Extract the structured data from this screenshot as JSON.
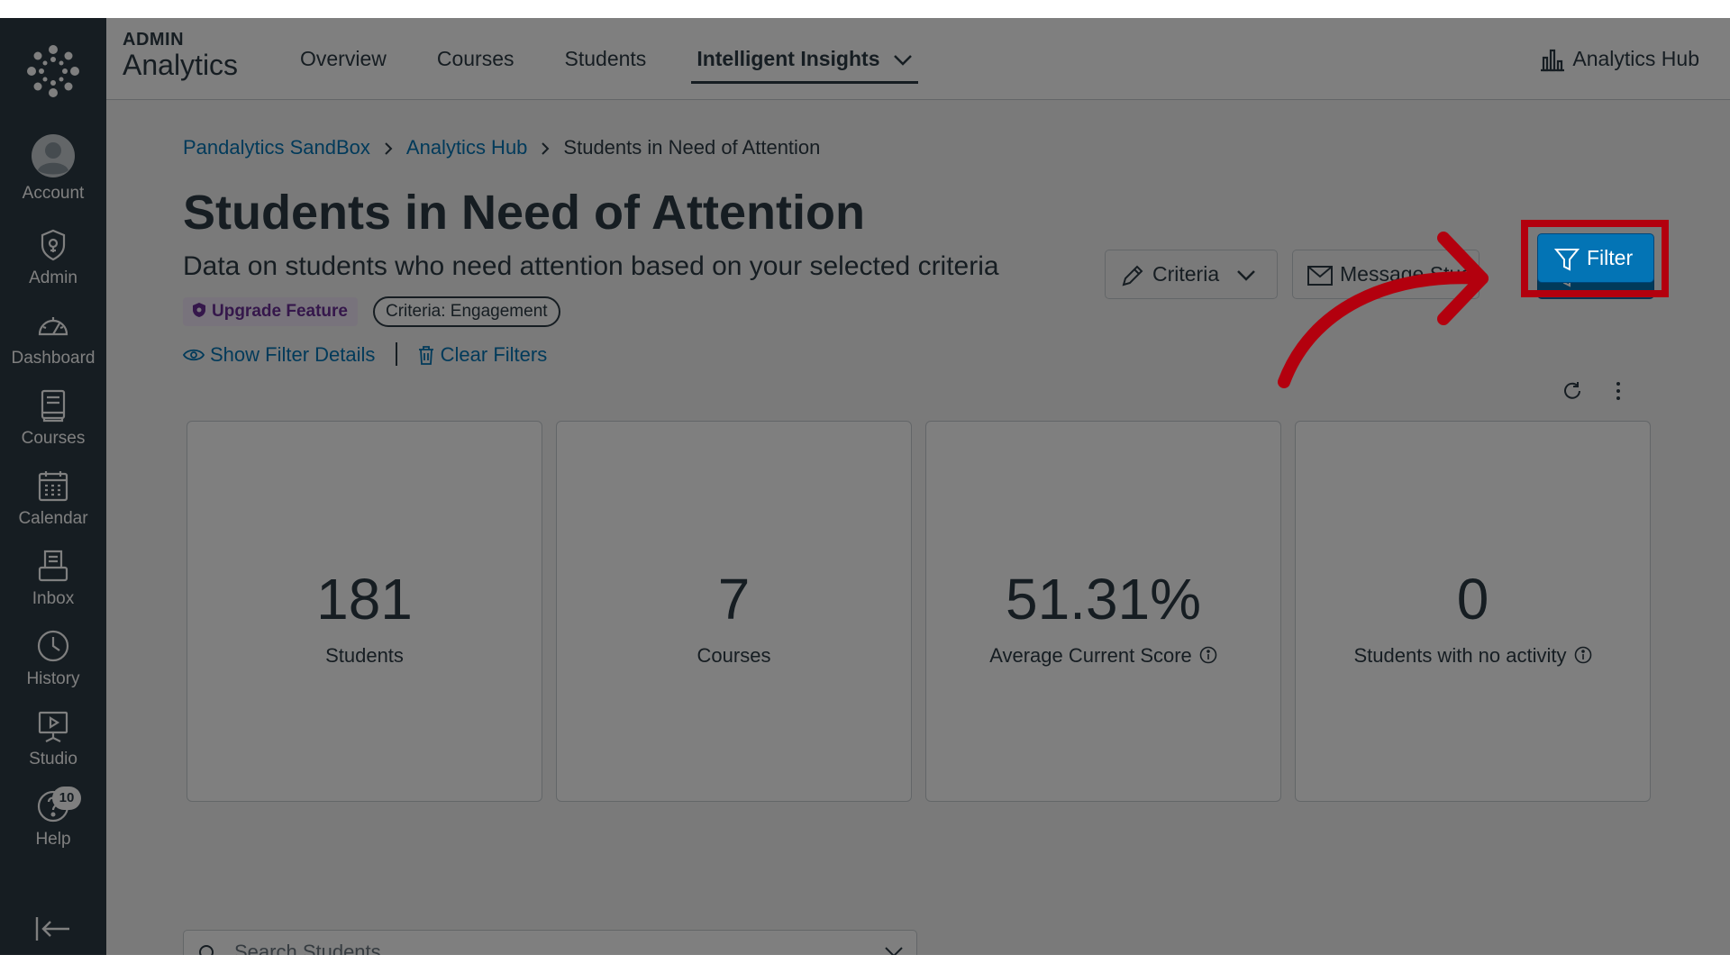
{
  "nav": {
    "items": [
      {
        "label": "Account",
        "icon": "account-icon"
      },
      {
        "label": "Admin",
        "icon": "admin-icon"
      },
      {
        "label": "Dashboard",
        "icon": "dashboard-icon"
      },
      {
        "label": "Courses",
        "icon": "courses-icon"
      },
      {
        "label": "Calendar",
        "icon": "calendar-icon"
      },
      {
        "label": "Inbox",
        "icon": "inbox-icon"
      },
      {
        "label": "History",
        "icon": "history-icon"
      },
      {
        "label": "Studio",
        "icon": "studio-icon"
      },
      {
        "label": "Help",
        "icon": "help-icon"
      }
    ],
    "help_badge": "10"
  },
  "header": {
    "brand_small": "ADMIN",
    "brand_big": "Analytics",
    "tabs": [
      {
        "label": "Overview"
      },
      {
        "label": "Courses"
      },
      {
        "label": "Students"
      },
      {
        "label": "Intelligent Insights"
      }
    ],
    "hub_link": "Analytics Hub"
  },
  "breadcrumb": {
    "items": [
      "Pandalytics SandBox",
      "Analytics Hub",
      "Students in Need of Attention"
    ]
  },
  "page": {
    "title": "Students in Need of Attention",
    "subtitle": "Data on students who need attention based on your selected criteria",
    "upgrade_pill": "Upgrade Feature",
    "criteria_pill": "Criteria: Engagement",
    "show_filter_details": "Show Filter Details",
    "clear_filters": "Clear Filters"
  },
  "actions": {
    "criteria": "Criteria",
    "message": "Message Students",
    "filter": "Filter"
  },
  "stats": [
    {
      "value": "181",
      "label": "Students"
    },
    {
      "value": "7",
      "label": "Courses"
    },
    {
      "value": "51.31%",
      "label": "Average Current Score"
    },
    {
      "value": "0",
      "label": "Students with no activity"
    }
  ],
  "search": {
    "placeholder": "Search Students"
  },
  "colors": {
    "nav_bg": "#2d3b45",
    "link": "#0374b5",
    "primary_button": "#0374b5",
    "annotation_red": "#b3000e",
    "upgrade_purple": "#6b2f97"
  }
}
